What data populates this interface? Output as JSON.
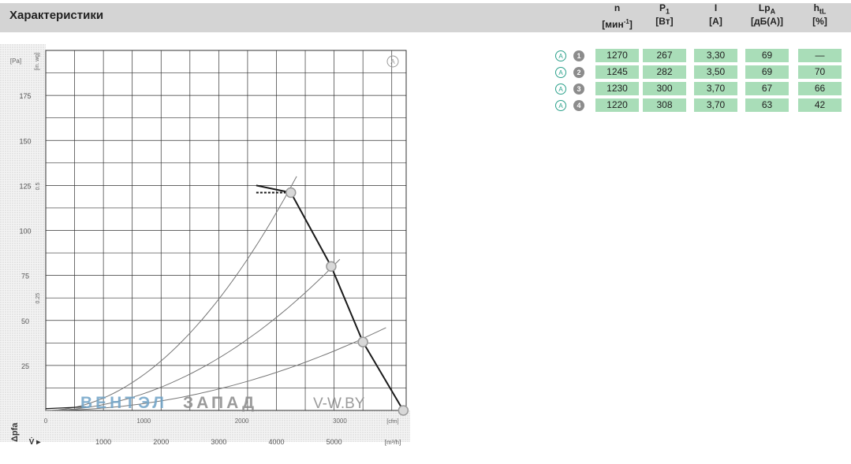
{
  "header": {
    "title": "Характеристики"
  },
  "table": {
    "columns": [
      {
        "sym": "n",
        "sub": "",
        "unit": "[мин",
        "unit_sup": "-1",
        "unit_end": "]"
      },
      {
        "sym": "P",
        "sub": "1",
        "unit": "[Вт]",
        "unit_sup": "",
        "unit_end": ""
      },
      {
        "sym": "I",
        "sub": "",
        "unit": "[A]",
        "unit_sup": "",
        "unit_end": ""
      },
      {
        "sym": "Lp",
        "sub": "A",
        "unit": "[дБ(A)]",
        "unit_sup": "",
        "unit_end": ""
      },
      {
        "sym": "h",
        "sub": "tL",
        "unit": "[%]",
        "unit_sup": "",
        "unit_end": ""
      }
    ],
    "row_marker_letter": "A",
    "rows": [
      {
        "num": "1",
        "cells": [
          "1270",
          "267",
          "3,30",
          "69",
          "—"
        ]
      },
      {
        "num": "2",
        "cells": [
          "1245",
          "282",
          "3,50",
          "69",
          "70"
        ]
      },
      {
        "num": "3",
        "cells": [
          "1230",
          "300",
          "3,70",
          "67",
          "66"
        ]
      },
      {
        "num": "4",
        "cells": [
          "1220",
          "308",
          "3,70",
          "63",
          "42"
        ]
      }
    ],
    "cell_color": "#a9ddb8"
  },
  "chart_data": {
    "type": "line",
    "title": "",
    "marker_label": "A",
    "xlabel": "[m³/h]",
    "ylabel": "Δpfa",
    "y_unit": "[Pa]",
    "x_alt_label": "[cfm]",
    "y_alt_unit": "[in. wg]",
    "xlim": [
      0,
      6250
    ],
    "ylim": [
      0,
      200
    ],
    "x_ticks": [
      1000,
      2000,
      3000,
      4000,
      5000
    ],
    "y_ticks": [
      25,
      50,
      75,
      100,
      125,
      150,
      175
    ],
    "y_tick_labels": [
      "25",
      "50",
      "75",
      "100",
      "125",
      "150",
      "175"
    ],
    "y_alt_ticks": [
      {
        "value": 62.3,
        "label": "0.25"
      },
      {
        "value": 124.5,
        "label": "0.5"
      }
    ],
    "x_alt_ticks": [
      {
        "value": 0,
        "label": "0"
      },
      {
        "value": 1700,
        "label": "1000"
      },
      {
        "value": 3400,
        "label": "2000"
      },
      {
        "value": 5100,
        "label": "3000"
      }
    ],
    "grid": true,
    "series": [
      {
        "x": [
          3650,
          4250,
          4950,
          5500,
          6200
        ],
        "y": [
          125,
          121,
          80,
          38,
          0
        ]
      }
    ],
    "operating_points": [
      {
        "label": "1",
        "x": 6200,
        "y": 0
      },
      {
        "label": "2",
        "x": 5500,
        "y": 38
      },
      {
        "label": "3",
        "x": 4950,
        "y": 80
      },
      {
        "label": "4",
        "x": 4250,
        "y": 121
      }
    ],
    "system_curves": [
      {
        "to_x": 4350,
        "to_y": 130
      },
      {
        "to_x": 5100,
        "to_y": 84
      },
      {
        "to_x": 5900,
        "to_y": 46
      }
    ],
    "stall_start_x": 3650,
    "stall_y": 121,
    "colors": {
      "curve": "#1a1a1a",
      "system": "#777777",
      "grid": "#333333",
      "point": "#9a9a9a"
    }
  },
  "watermark": {
    "part1": "ВЕНТЭЛ",
    "part2": "ЗАПАД",
    "part3": "V-W.BY",
    "color1": "#6fa3c7",
    "color2": "#8a8a8a"
  }
}
